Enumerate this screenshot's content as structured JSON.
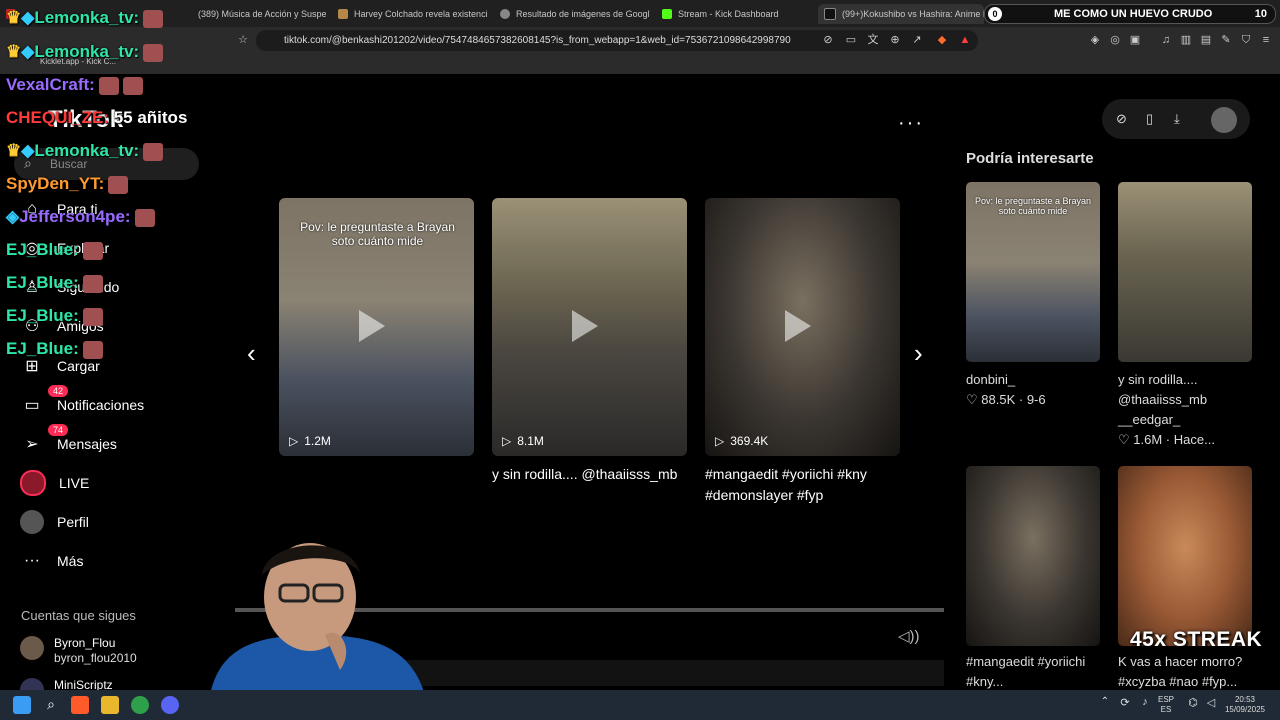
{
  "browser": {
    "tabs": [
      {
        "label": "(389) Música de Acción y Suspenso | ...",
        "x": 0
      },
      {
        "label": "Harvey Colchado revela existencia d...",
        "x": 0
      },
      {
        "label": "Resultado de imágenes de Google",
        "x": 0
      },
      {
        "label": "Stream - Kick Dashboard",
        "x": 0
      },
      {
        "label": "(99+)Kokushibo vs Hashira: Anime E...",
        "x": 0
      }
    ],
    "url": "tiktok.com/@benkashi201202/video/7547484657382608145?is_from_webapp=1&web_id=7536721098642998790",
    "bookmark": "Kicklet.app - Kick C...",
    "notification": {
      "badge": "0",
      "message": "ME COMO UN HUEVO CRUDO",
      "count": "10"
    }
  },
  "tiktok": {
    "search_placeholder": "Buscar",
    "nav": [
      {
        "label": "Para ti",
        "icon": "home-icon"
      },
      {
        "label": "Explorar",
        "icon": "compass-icon"
      },
      {
        "label": "Siguiendo",
        "icon": "following-icon"
      },
      {
        "label": "Amigos",
        "icon": "friends-icon"
      },
      {
        "label": "Cargar",
        "icon": "upload-icon"
      },
      {
        "label": "Notificaciones",
        "icon": "inbox-icon",
        "badge": "42"
      },
      {
        "label": "Mensajes",
        "icon": "send-icon",
        "badge": "74"
      },
      {
        "label": "LIVE",
        "icon": "live-icon"
      },
      {
        "label": "Perfil",
        "icon": "profile-icon"
      },
      {
        "label": "Más",
        "icon": "more-icon"
      }
    ],
    "following_title": "Cuentas que sigues",
    "following": [
      {
        "name": "Byron_Flou",
        "handle": "byron_flou2010"
      },
      {
        "name": "MiniScriptz",
        "handle": ""
      }
    ],
    "videos": [
      {
        "views": "1.2M",
        "caption": "",
        "overlay": "Pov: le preguntaste a Brayan soto cuánto mide"
      },
      {
        "views": "8.1M",
        "caption": "y sin rodilla.... @thaaiisss_mb",
        "overlay": ""
      },
      {
        "views": "369.4K",
        "caption": "#mangaedit #yoriichi #kny #demonslayer #fyp",
        "overlay": ""
      }
    ],
    "recommended_title": "Podría interesarte",
    "recommended": [
      {
        "author": "donbini_",
        "likes": "88.5K",
        "date": "9-6",
        "title": "",
        "overlay": "Pov: le preguntaste a Brayan soto cuánto mide"
      },
      {
        "author": "__eedgar_",
        "likes": "1.6M",
        "date": "Hace...",
        "title": "y sin rodilla.... @thaaiisss_mb"
      },
      {
        "author": "",
        "likes": "",
        "date": "",
        "title": "#mangaedit #yoriichi #kny..."
      },
      {
        "author": "",
        "likes": "",
        "date": "",
        "title": "K vas a hacer morro? #xcyzba #nao #fyp..."
      }
    ],
    "streak": "45x STREAK"
  },
  "chat": [
    {
      "user": "Lemonka_tv:",
      "text": "",
      "color": "#2ee6a8"
    },
    {
      "user": "Lemonka_tv:",
      "text": "",
      "color": "#2ee6a8"
    },
    {
      "user": "VexalCraft:",
      "text": "",
      "color": "#9a6bff"
    },
    {
      "user": "CHEQUI_ZE:",
      "text": "55 añitos",
      "color": "#ff3a3a"
    },
    {
      "user": "Lemonka_tv:",
      "text": "",
      "color": "#2ee6a8"
    },
    {
      "user": "SpyDen_YT:",
      "text": "",
      "color": "#ff9a2e"
    },
    {
      "user": "Jefferson4pe:",
      "text": "",
      "color": "#9a6bff"
    },
    {
      "user": "EJ_Blue:",
      "text": "",
      "color": "#2ee6a8"
    },
    {
      "user": "EJ_Blue:",
      "text": "",
      "color": "#2ee6a8"
    },
    {
      "user": "EJ_Blue:",
      "text": "",
      "color": "#2ee6a8"
    },
    {
      "user": "EJ_Blue:",
      "text": "",
      "color": "#2ee6a8"
    }
  ],
  "taskbar": {
    "lang": "ESP",
    "lang2": "ES",
    "time": "20:53",
    "date": "15/09/2025"
  }
}
